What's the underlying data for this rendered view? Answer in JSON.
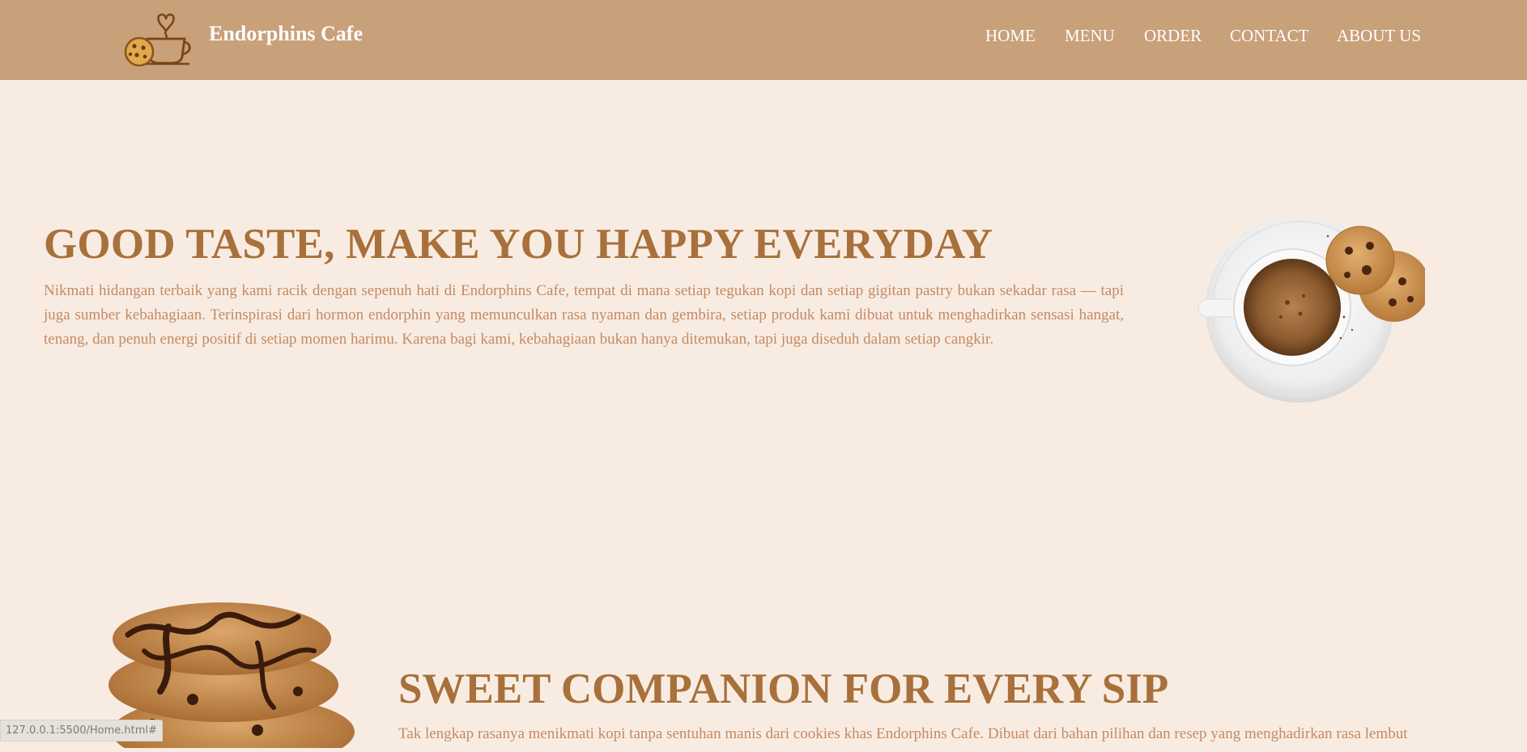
{
  "header": {
    "brand": "Endorphins Cafe",
    "nav": [
      {
        "label": "HOME"
      },
      {
        "label": "MENU"
      },
      {
        "label": "ORDER"
      },
      {
        "label": "CONTACT"
      },
      {
        "label": "ABOUT US"
      }
    ]
  },
  "hero": {
    "title": "GOOD TASTE, MAKE YOU HAPPY EVERYDAY",
    "text": "Nikmati hidangan terbaik yang kami racik dengan sepenuh hati di Endorphins Cafe, tempat di mana setiap tegukan kopi dan setiap gigitan pastry bukan sekadar rasa — tapi juga sumber kebahagiaan. Terinspirasi dari hormon endorphin yang memunculkan rasa nyaman dan gembira, setiap produk kami dibuat untuk menghadirkan sensasi hangat, tenang, dan penuh energi positif di setiap momen harimu. Karena bagi kami, kebahagiaan bukan hanya ditemukan, tapi juga diseduh dalam setiap cangkir."
  },
  "section2": {
    "title": "SWEET COMPANION FOR EVERY SIP",
    "text": "Tak lengkap rasanya menikmati kopi tanpa sentuhan manis dari cookies khas Endorphins Cafe. Dibuat dari bahan pilihan dan resep yang menghadirkan rasa lembut"
  },
  "status_bar": {
    "url": "127.0.0.1:5500/Home.html#"
  },
  "colors": {
    "navbar": "#c8a07a",
    "page_bg": "#f8ece2",
    "heading": "#a8703a",
    "body_text": "#c48a62"
  },
  "icons": {
    "logo": "coffee-cup-cookie-icon",
    "hero_image": "coffee-cup-cookies-image",
    "section2_image": "chocolate-cookies-stack-image"
  }
}
